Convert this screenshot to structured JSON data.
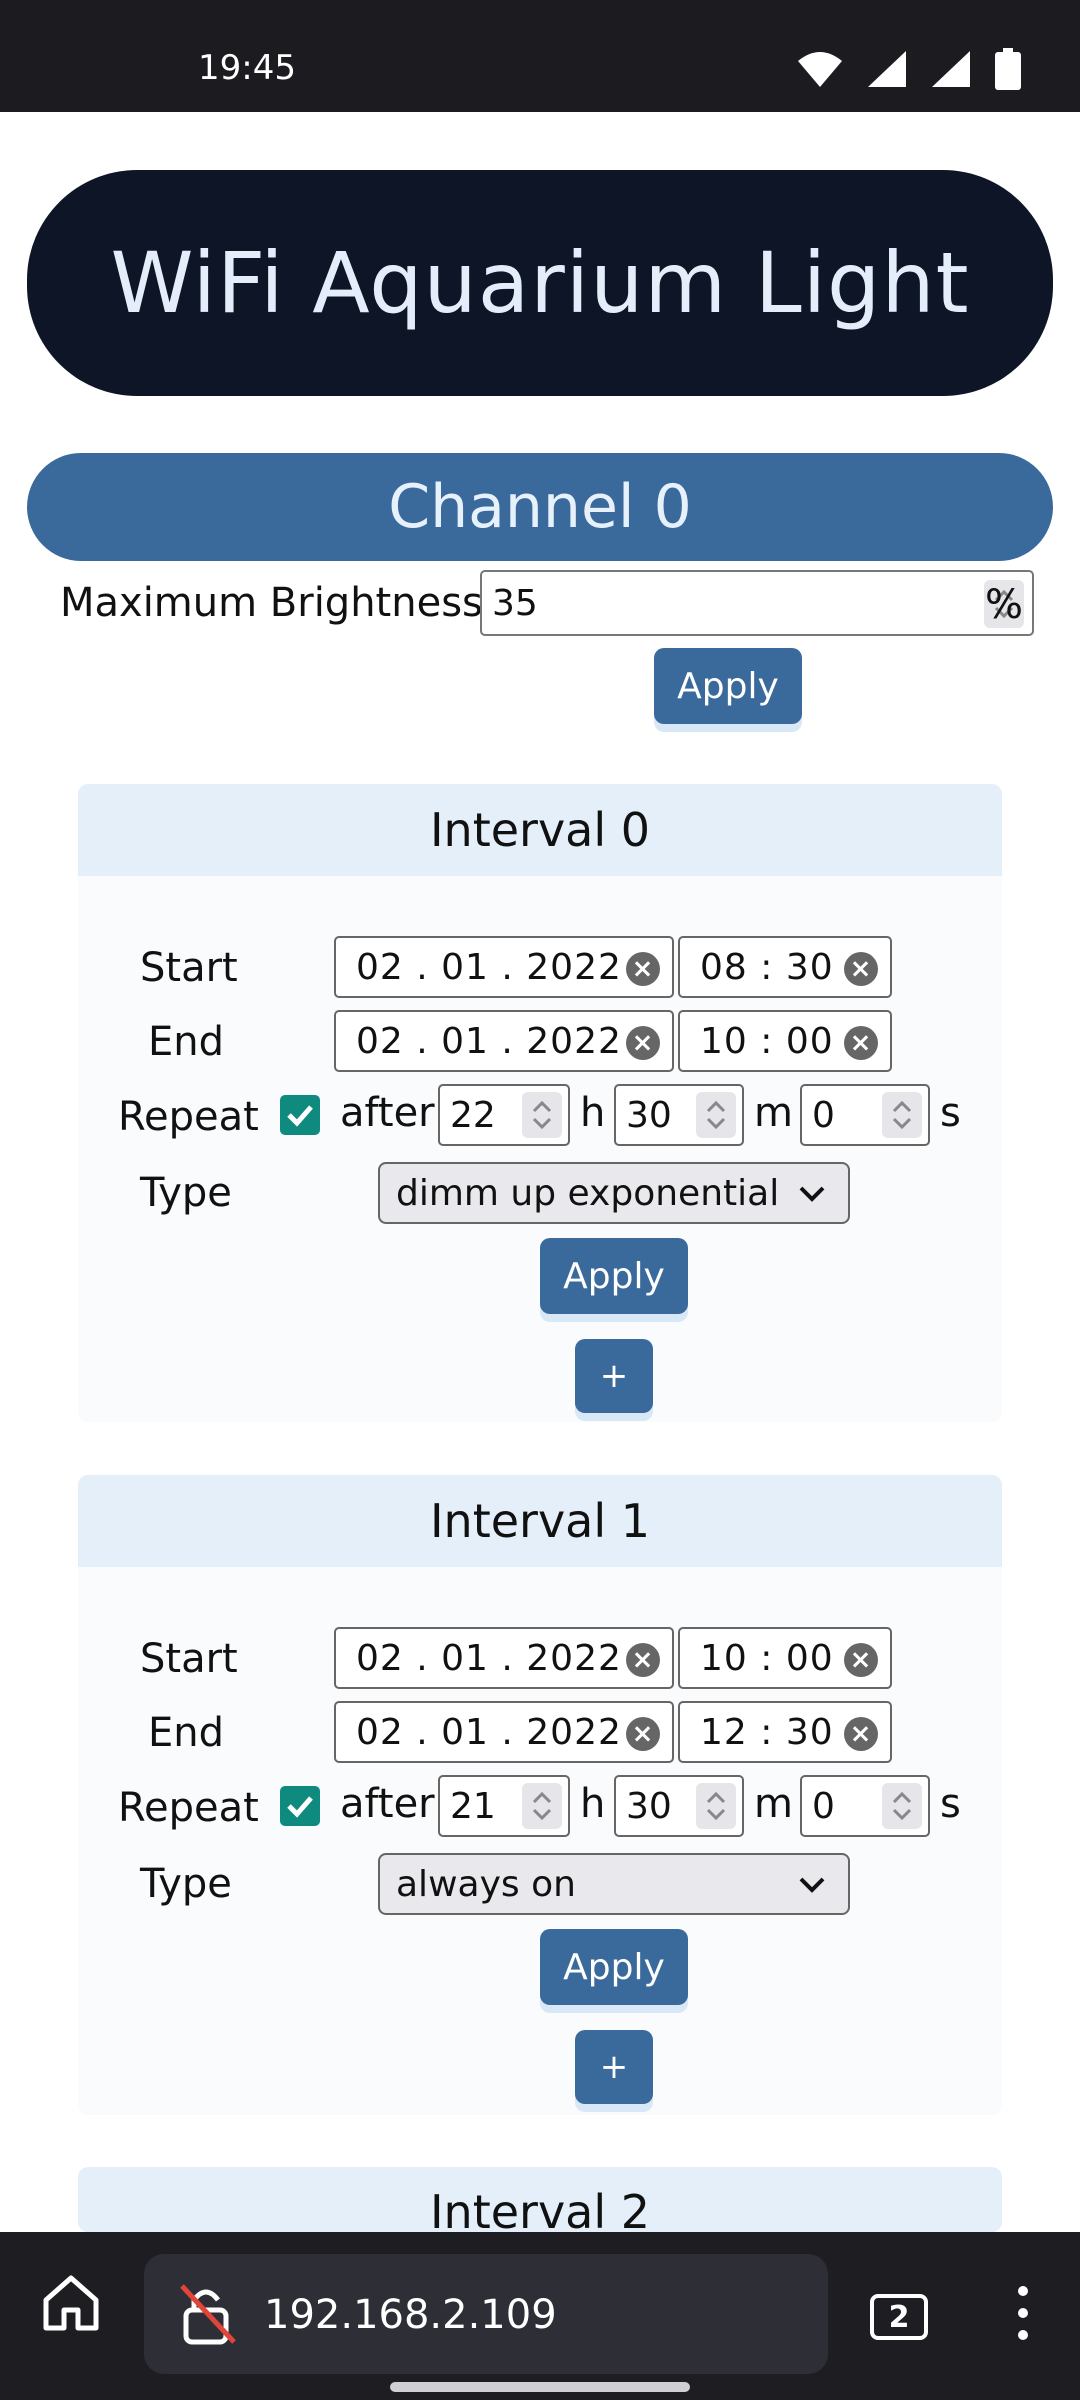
{
  "status": {
    "time": "19:45"
  },
  "header": {
    "title": "WiFi Aquarium Light"
  },
  "channel": {
    "title": "Channel 0",
    "max_brightness_label": "Maximum Brightness",
    "max_brightness_value": "35",
    "unit": "%",
    "apply_label": "Apply"
  },
  "labels": {
    "start": "Start",
    "end": "End",
    "repeat": "Repeat",
    "type": "Type",
    "after": "after",
    "h": "h",
    "m": "m",
    "s": "s",
    "apply": "Apply",
    "plus": "+"
  },
  "intervals": [
    {
      "title": "Interval 0",
      "start_date": "02 . 01 . 2022",
      "start_time": "08 : 30",
      "end_date": "02 . 01 . 2022",
      "end_time": "10 : 00",
      "repeat": true,
      "hours": "22",
      "minutes": "30",
      "seconds": "0",
      "type": "dimm up exponential"
    },
    {
      "title": "Interval 1",
      "start_date": "02 . 01 . 2022",
      "start_time": "10 : 00",
      "end_date": "02 . 01 . 2022",
      "end_time": "12 : 30",
      "repeat": true,
      "hours": "21",
      "minutes": "30",
      "seconds": "0",
      "type": "always on"
    },
    {
      "title": "Interval 2"
    }
  ],
  "browser": {
    "url": "192.168.2.109",
    "tab_count": "2"
  }
}
